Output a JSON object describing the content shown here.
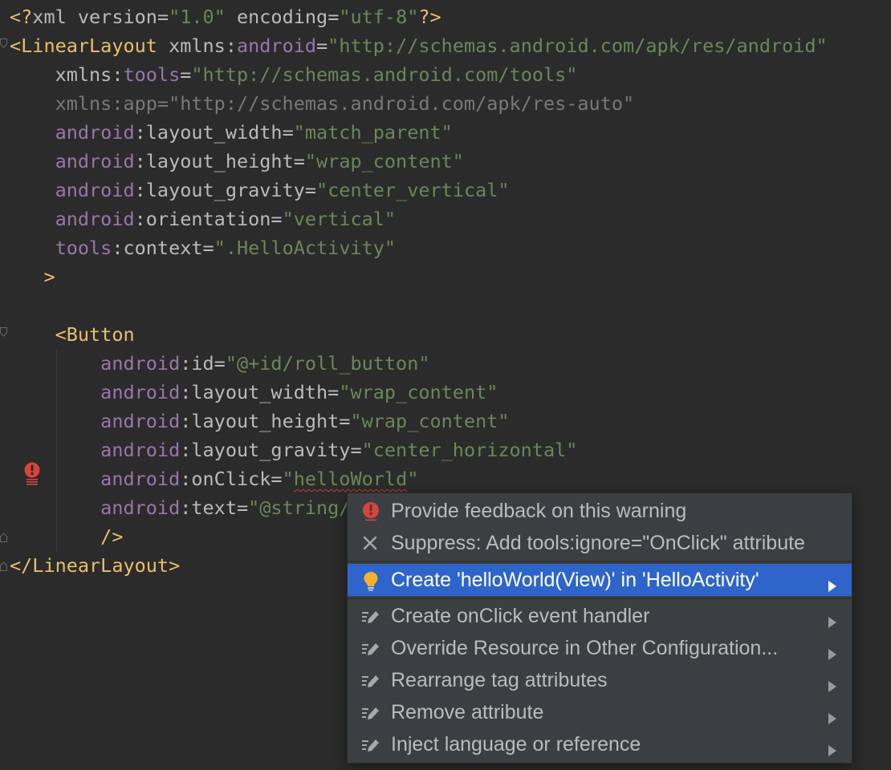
{
  "editor": {
    "lines": [
      [
        {
          "t": "<?",
          "c": "t-tag"
        },
        {
          "t": "xml version",
          "c": "t-attr"
        },
        {
          "t": "=",
          "c": "t-attr"
        },
        {
          "t": "\"1.0\"",
          "c": "t-val"
        },
        {
          "t": " encoding",
          "c": "t-attr"
        },
        {
          "t": "=",
          "c": "t-attr"
        },
        {
          "t": "\"utf-8\"",
          "c": "t-val"
        },
        {
          "t": "?>",
          "c": "t-tag"
        }
      ],
      [
        {
          "t": "<LinearLayout",
          "c": "t-tag"
        },
        {
          "t": " xmlns:",
          "c": "t-attr"
        },
        {
          "t": "android",
          "c": "t-ns"
        },
        {
          "t": "=",
          "c": "t-attr"
        },
        {
          "t": "\"http://schemas.android.com/apk/res/android\"",
          "c": "t-val"
        }
      ],
      [
        {
          "t": "    xmlns:",
          "c": "t-attr"
        },
        {
          "t": "tools",
          "c": "t-ns"
        },
        {
          "t": "=",
          "c": "t-attr"
        },
        {
          "t": "\"http://schemas.android.com/tools\"",
          "c": "t-val"
        }
      ],
      [
        {
          "t": "    xmlns:app=\"http://schemas.android.com/apk/res-auto\"",
          "c": "t-dim"
        }
      ],
      [
        {
          "t": "    android",
          "c": "t-ns"
        },
        {
          "t": ":layout_width=",
          "c": "t-attr"
        },
        {
          "t": "\"match_parent\"",
          "c": "t-val"
        }
      ],
      [
        {
          "t": "    android",
          "c": "t-ns"
        },
        {
          "t": ":layout_height=",
          "c": "t-attr"
        },
        {
          "t": "\"wrap_content\"",
          "c": "t-val"
        }
      ],
      [
        {
          "t": "    android",
          "c": "t-ns"
        },
        {
          "t": ":layout_gravity=",
          "c": "t-attr"
        },
        {
          "t": "\"center_vertical\"",
          "c": "t-val"
        }
      ],
      [
        {
          "t": "    android",
          "c": "t-ns"
        },
        {
          "t": ":orientation=",
          "c": "t-attr"
        },
        {
          "t": "\"vertical\"",
          "c": "t-val"
        }
      ],
      [
        {
          "t": "    tools",
          "c": "t-ns"
        },
        {
          "t": ":context=",
          "c": "t-attr"
        },
        {
          "t": "\".HelloActivity\"",
          "c": "t-val"
        }
      ],
      [
        {
          "t": "   >",
          "c": "t-tag"
        }
      ],
      [],
      [
        {
          "t": "    <Button",
          "c": "t-tag"
        }
      ],
      [
        {
          "t": "        android",
          "c": "t-ns"
        },
        {
          "t": ":id=",
          "c": "t-attr"
        },
        {
          "t": "\"@+id/roll_button\"",
          "c": "t-val"
        }
      ],
      [
        {
          "t": "        android",
          "c": "t-ns"
        },
        {
          "t": ":layout_width=",
          "c": "t-attr"
        },
        {
          "t": "\"wrap_content\"",
          "c": "t-val"
        }
      ],
      [
        {
          "t": "        android",
          "c": "t-ns"
        },
        {
          "t": ":layout_height=",
          "c": "t-attr"
        },
        {
          "t": "\"wrap_content\"",
          "c": "t-val"
        }
      ],
      [
        {
          "t": "        android",
          "c": "t-ns"
        },
        {
          "t": ":layout_gravity=",
          "c": "t-attr"
        },
        {
          "t": "\"center_horizontal\"",
          "c": "t-val"
        }
      ],
      [
        {
          "t": "        android",
          "c": "t-ns"
        },
        {
          "t": ":onClick=",
          "c": "t-attr"
        },
        {
          "t": "\"",
          "c": "t-val"
        },
        {
          "t": "helloWorld",
          "c": "t-val squiggle"
        },
        {
          "t": "\"",
          "c": "t-val"
        }
      ],
      [
        {
          "t": "        android",
          "c": "t-ns"
        },
        {
          "t": ":text=",
          "c": "t-attr"
        },
        {
          "t": "\"@string/",
          "c": "t-val"
        }
      ],
      [
        {
          "t": "        />",
          "c": "t-tag"
        }
      ],
      [
        {
          "t": "</LinearLayout>",
          "c": "t-tag"
        }
      ]
    ]
  },
  "popup": {
    "items": [
      {
        "icon": "error-icon",
        "label": "Provide feedback on this warning",
        "submenu": false
      },
      {
        "icon": "close-icon",
        "label": "Suppress: Add tools:ignore=\"OnClick\" attribute",
        "submenu": false
      },
      {
        "icon": "lightbulb-icon",
        "label": "Create 'helloWorld(View)' in 'HelloActivity'",
        "submenu": true,
        "selected": true
      },
      {
        "icon": "pencil-icon",
        "label": "Create onClick event handler",
        "submenu": true
      },
      {
        "icon": "pencil-icon",
        "label": "Override Resource in Other Configuration...",
        "submenu": true
      },
      {
        "icon": "pencil-icon",
        "label": "Rearrange tag attributes",
        "submenu": true
      },
      {
        "icon": "pencil-icon",
        "label": "Remove attribute",
        "submenu": true
      },
      {
        "icon": "pencil-icon",
        "label": "Inject language or reference",
        "submenu": true
      }
    ]
  },
  "colors": {
    "background": "#2b2b2b",
    "popup_background": "#3c3f41",
    "selection": "#2f65ca",
    "tag": "#e8bf6a",
    "namespace": "#9876aa",
    "string": "#6a8759",
    "error": "#d7443c",
    "bulb": "#f4b12e"
  }
}
